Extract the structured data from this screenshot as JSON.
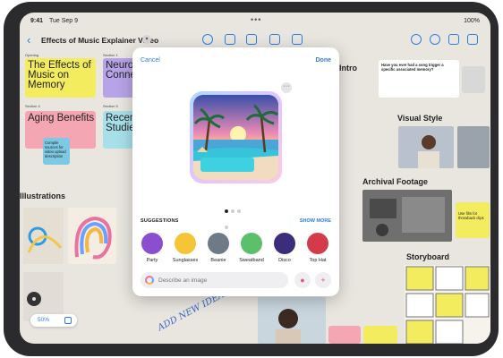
{
  "status": {
    "time": "9:41",
    "date": "Tue Sep 9",
    "battery": "100%"
  },
  "toolbar": {
    "back_icon": "chevron-left-icon",
    "title": "Effects of Music Explainer Video"
  },
  "board": {
    "sections": [
      "Opening",
      "Section 1",
      "Section 2",
      "Section 3",
      "Section 4",
      "Section 5"
    ],
    "cards": [
      "The Effects of Music on Memory",
      "Neurological Connections",
      "Aging Benefits",
      "Recent Studies"
    ],
    "headings": [
      "Intro",
      "Visual Style",
      "Archival Footage",
      "Storyboard",
      "Illustrations"
    ],
    "notes": [
      "Have you ever had a song trigger a specific associated memory?",
      "Use film for throwback clips",
      "Compile sources for video upload description"
    ],
    "zoom": "50%",
    "handwriting": "ADD NEW IDEAS"
  },
  "modal": {
    "cancel": "Cancel",
    "done": "Done",
    "more_icon": "ellipsis-icon",
    "suggestions_label": "SUGGESTIONS",
    "show_more": "SHOW MORE",
    "suggestions": [
      "Party",
      "Sunglasses",
      "Beanie",
      "Sweatband",
      "Disco",
      "Top Hat"
    ],
    "prompt_placeholder": "Describe an image",
    "pager": {
      "pages": 4,
      "current": 1
    }
  },
  "colors": {
    "accent": "#2f7de1",
    "sticky_yellow": "#f2ec5e",
    "sticky_purple": "#b7a3e8",
    "sticky_pink": "#f4a6b3"
  }
}
